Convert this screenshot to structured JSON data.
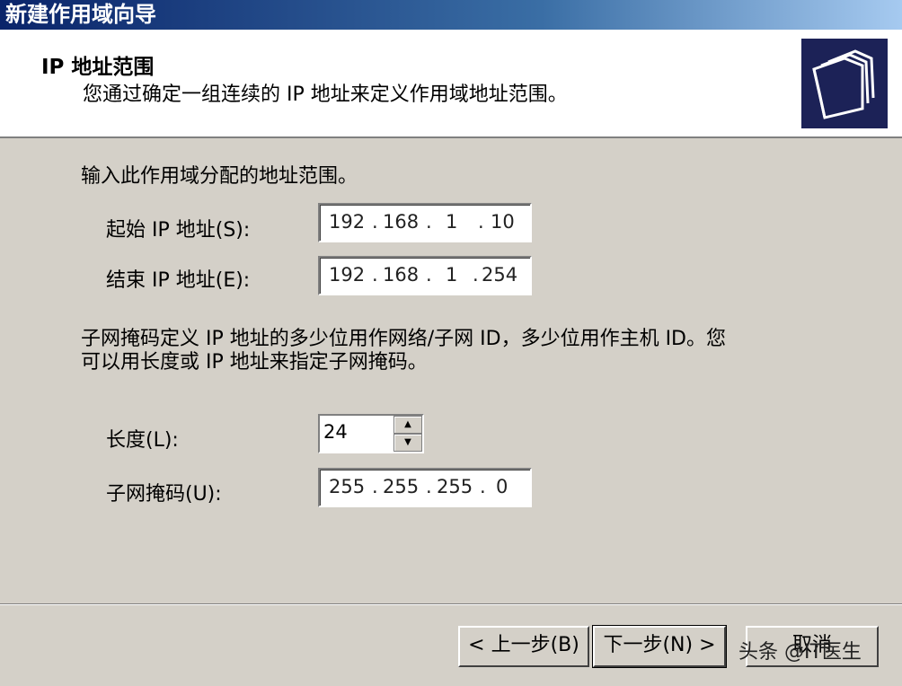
{
  "window": {
    "title": "新建作用域向导"
  },
  "header": {
    "title": "IP 地址范围",
    "subtitle": "您通过确定一组连续的 IP 地址来定义作用域地址范围。",
    "icon": "folders-icon"
  },
  "range": {
    "intro": "输入此作用域分配的地址范围。",
    "start_label": "起始 IP 地址(S):",
    "start_ip": [
      "192",
      "168",
      "1",
      "10"
    ],
    "end_label": "结束 IP 地址(E):",
    "end_ip": [
      "192",
      "168",
      "1",
      "254"
    ]
  },
  "subnet": {
    "description_line1": "子网掩码定义 IP 地址的多少位用作网络/子网 ID，多少位用作主机 ID。您",
    "description_line2": "可以用长度或 IP 地址来指定子网掩码。",
    "length_label": "长度(L):",
    "length_value": "24",
    "mask_label": "子网掩码(U):",
    "mask_ip": [
      "255",
      "255",
      "255",
      "0"
    ]
  },
  "buttons": {
    "back": "< 上一步(B)",
    "next": "下一步(N) >",
    "cancel": "取消"
  },
  "watermark": "头条 @IT医生"
}
